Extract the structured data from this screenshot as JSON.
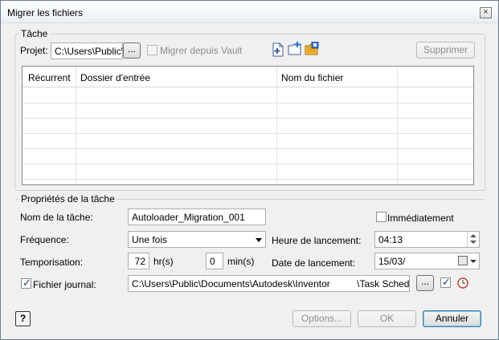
{
  "window": {
    "title": "Migrer les fichiers"
  },
  "task_group": {
    "label": "Tâche",
    "project_label": "Projet:",
    "project_value": "C:\\Users\\Public\\D",
    "browse_label": "...",
    "vault_label": "Migrer depuis Vault",
    "delete_label": "Supprimer",
    "toolbar_icons": [
      "new-task-icon",
      "add-folder-icon",
      "vault-folder-icon"
    ]
  },
  "grid": {
    "columns": [
      "Récurrent",
      "Dossier d'entrée",
      "Nom du fichier",
      ""
    ],
    "rows": []
  },
  "properties": {
    "label": "Propriétés de la tâche",
    "task_name_label": "Nom de la tâche:",
    "task_name_value": "Autoloader_Migration_001",
    "immediate_label": "Immédiatement",
    "frequency_label": "Fréquence:",
    "frequency_value": "Une fois",
    "start_time_label": "Heure de lancement:",
    "start_time_value": "04:13",
    "delay_label": "Temporisation:",
    "delay_hours_value": "72",
    "delay_hours_unit": "hr(s)",
    "delay_mins_value": "0",
    "delay_mins_unit": "min(s)",
    "start_date_label": "Date de lancement:",
    "start_date_value": "15/03/",
    "log_label": "Fichier journal:",
    "log_checked": true,
    "log_path": "C:\\Users\\Public\\Documents\\Autodesk\\Inventor          \\Task Scheduler Lo",
    "log_browse_label": "...",
    "log_open_checked": true
  },
  "footer": {
    "help_icon": "help-icon",
    "options_label": "Options...",
    "ok_label": "OK",
    "cancel_label": "Annuler"
  }
}
